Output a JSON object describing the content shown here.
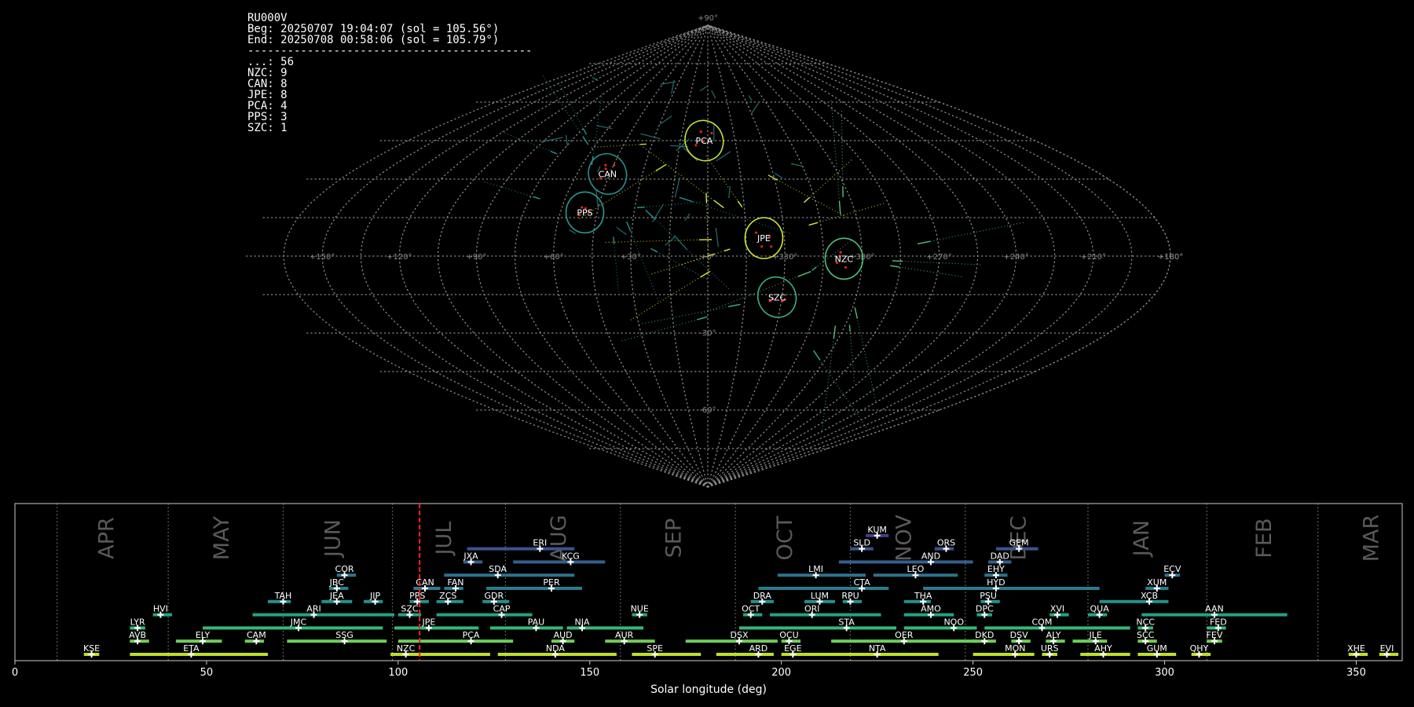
{
  "header": {
    "station": "RU000V",
    "begin": "Beg: 20250707 19:04:07 (sol = 105.56°)",
    "end": "End: 20250708 00:58:06 (sol = 105.79°)",
    "separator": "-------------------------------------------",
    "counts": [
      {
        "code": "...",
        "count": 56
      },
      {
        "code": "NZC",
        "count": 9
      },
      {
        "code": "CAN",
        "count": 8
      },
      {
        "code": "JPE",
        "count": 8
      },
      {
        "code": "PCA",
        "count": 4
      },
      {
        "code": "PPS",
        "count": 3
      },
      {
        "code": "SZC",
        "count": 1
      }
    ]
  },
  "chart_data": [
    {
      "type": "scatter",
      "projection": "sinusoidal",
      "ra_ticks": [
        "+180°",
        "+150°",
        "+120°",
        "+90°",
        "+60°",
        "+30°",
        "+0°",
        "+330°",
        "+300°",
        "+270°",
        "+240°",
        "+210°",
        "+180°"
      ],
      "dec_ticks": [
        "+90°",
        "-30°",
        "-60°",
        "-90°"
      ],
      "showers": [
        {
          "code": "PCA",
          "ra": 2,
          "dec": 45,
          "color": "#c5e03c"
        },
        {
          "code": "CAN",
          "ra": 46,
          "dec": 32,
          "color": "#2a8c8c"
        },
        {
          "code": "PPS",
          "ra": 50,
          "dec": 17,
          "color": "#2a9a8f"
        },
        {
          "code": "JPE",
          "ra": 338,
          "dec": 7,
          "color": "#d6e834"
        },
        {
          "code": "NZC",
          "ra": 307,
          "dec": -1,
          "color": "#52c07a"
        },
        {
          "code": "SZC",
          "ra": 332,
          "dec": -16,
          "color": "#3bb08a"
        }
      ]
    },
    {
      "type": "timeline",
      "xlabel": "Solar longitude (deg)",
      "xlim": [
        0,
        362
      ],
      "x_ticks": [
        0,
        50,
        100,
        150,
        200,
        250,
        300,
        350
      ],
      "current_sol": 105.6,
      "months": [
        {
          "label": "APR",
          "sol": 24
        },
        {
          "label": "MAY",
          "sol": 54
        },
        {
          "label": "JUN",
          "sol": 83
        },
        {
          "label": "JUL",
          "sol": 112
        },
        {
          "label": "AUG",
          "sol": 142
        },
        {
          "label": "SEP",
          "sol": 172
        },
        {
          "label": "OCT",
          "sol": 201
        },
        {
          "label": "NOV",
          "sol": 232
        },
        {
          "label": "DEC",
          "sol": 262
        },
        {
          "label": "JAN",
          "sol": 294
        },
        {
          "label": "FEB",
          "sol": 326
        },
        {
          "label": "MAR",
          "sol": 354
        }
      ],
      "month_boundaries": [
        11,
        40,
        70,
        98.5,
        128,
        158,
        188,
        218,
        248,
        280,
        311,
        340
      ],
      "showers": [
        {
          "code": "KUM",
          "start": 222,
          "end": 228,
          "peak": 225,
          "row": 10,
          "color": "#433e85"
        },
        {
          "code": "ERI",
          "start": 118,
          "end": 146,
          "peak": 137,
          "row": 9,
          "color": "#3b528b"
        },
        {
          "code": "SLD",
          "start": 218,
          "end": 224,
          "peak": 221,
          "row": 9,
          "color": "#3b528b"
        },
        {
          "code": "ORS",
          "start": 240,
          "end": 245,
          "peak": 243,
          "row": 9,
          "color": "#3b528b"
        },
        {
          "code": "GEM",
          "start": 256,
          "end": 267,
          "peak": 262,
          "row": 9,
          "color": "#3b528b"
        },
        {
          "code": "JXA",
          "start": 117,
          "end": 122,
          "peak": 119,
          "row": 8,
          "color": "#355f8d"
        },
        {
          "code": "KCG",
          "start": 130,
          "end": 154,
          "peak": 145,
          "row": 8,
          "color": "#355f8d"
        },
        {
          "code": "AND",
          "start": 215,
          "end": 250,
          "peak": 239,
          "row": 8,
          "color": "#355f8d"
        },
        {
          "code": "DAD",
          "start": 254,
          "end": 260,
          "peak": 257,
          "row": 8,
          "color": "#355f8d"
        },
        {
          "code": "COR",
          "start": 84,
          "end": 89,
          "peak": 86,
          "row": 7,
          "color": "#2c728e"
        },
        {
          "code": "SDA",
          "start": 112,
          "end": 146,
          "peak": 126,
          "row": 7,
          "color": "#2c728e"
        },
        {
          "code": "LMI",
          "start": 199,
          "end": 222,
          "peak": 209,
          "row": 7,
          "color": "#2c728e"
        },
        {
          "code": "LEO",
          "start": 224,
          "end": 246,
          "peak": 235,
          "row": 7,
          "color": "#2c728e"
        },
        {
          "code": "EHY",
          "start": 253,
          "end": 259,
          "peak": 256,
          "row": 7,
          "color": "#2c728e"
        },
        {
          "code": "ECV",
          "start": 300,
          "end": 304,
          "peak": 302,
          "row": 7,
          "color": "#2c728e"
        },
        {
          "code": "JBC",
          "start": 82,
          "end": 87,
          "peak": 84,
          "row": 6,
          "color": "#287d8e"
        },
        {
          "code": "CAN",
          "start": 104,
          "end": 111,
          "peak": 107,
          "row": 6,
          "color": "#287d8e"
        },
        {
          "code": "FAN",
          "start": 112,
          "end": 117,
          "peak": 115,
          "row": 6,
          "color": "#287d8e"
        },
        {
          "code": "PER",
          "start": 123,
          "end": 148,
          "peak": 140,
          "row": 6,
          "color": "#287d8e"
        },
        {
          "code": "CTA",
          "start": 194,
          "end": 228,
          "peak": 221,
          "row": 6,
          "color": "#287d8e"
        },
        {
          "code": "HYD",
          "start": 237,
          "end": 283,
          "peak": 256,
          "row": 6,
          "color": "#287d8e"
        },
        {
          "code": "XUM",
          "start": 295,
          "end": 301,
          "peak": 298,
          "row": 6,
          "color": "#287d8e"
        },
        {
          "code": "TAH",
          "start": 66,
          "end": 72,
          "peak": 70,
          "row": 5,
          "color": "#21918c"
        },
        {
          "code": "JEA",
          "start": 80,
          "end": 88,
          "peak": 84,
          "row": 5,
          "color": "#21918c"
        },
        {
          "code": "JIP",
          "start": 91,
          "end": 96,
          "peak": 94,
          "row": 5,
          "color": "#21918c"
        },
        {
          "code": "PPS",
          "start": 103,
          "end": 108,
          "peak": 105,
          "row": 5,
          "color": "#21918c"
        },
        {
          "code": "ZCS",
          "start": 110,
          "end": 117,
          "peak": 113,
          "row": 5,
          "color": "#21918c"
        },
        {
          "code": "GDR",
          "start": 122,
          "end": 129,
          "peak": 125,
          "row": 5,
          "color": "#21918c"
        },
        {
          "code": "DRA",
          "start": 192,
          "end": 198,
          "peak": 195,
          "row": 5,
          "color": "#21918c"
        },
        {
          "code": "LUM",
          "start": 206,
          "end": 214,
          "peak": 210,
          "row": 5,
          "color": "#21918c"
        },
        {
          "code": "RPU",
          "start": 216,
          "end": 221,
          "peak": 218,
          "row": 5,
          "color": "#21918c"
        },
        {
          "code": "THA",
          "start": 232,
          "end": 239,
          "peak": 237,
          "row": 5,
          "color": "#21918c"
        },
        {
          "code": "PSU",
          "start": 252,
          "end": 257,
          "peak": 254,
          "row": 5,
          "color": "#21918c"
        },
        {
          "code": "XCB",
          "start": 283,
          "end": 301,
          "peak": 296,
          "row": 5,
          "color": "#21918c"
        },
        {
          "code": "HVI",
          "start": 36,
          "end": 41,
          "peak": 38,
          "row": 4,
          "color": "#20a386"
        },
        {
          "code": "ARI",
          "start": 62,
          "end": 99,
          "peak": 78,
          "row": 4,
          "color": "#20a386"
        },
        {
          "code": "SZC",
          "start": 100,
          "end": 106,
          "peak": 103,
          "row": 4,
          "color": "#20a386"
        },
        {
          "code": "CAP",
          "start": 110,
          "end": 135,
          "peak": 127,
          "row": 4,
          "color": "#20a386"
        },
        {
          "code": "NUE",
          "start": 161,
          "end": 165,
          "peak": 163,
          "row": 4,
          "color": "#20a386"
        },
        {
          "code": "OCT",
          "start": 190,
          "end": 195,
          "peak": 192,
          "row": 4,
          "color": "#20a386"
        },
        {
          "code": "ORI",
          "start": 197,
          "end": 226,
          "peak": 208,
          "row": 4,
          "color": "#20a386"
        },
        {
          "code": "AMO",
          "start": 232,
          "end": 245,
          "peak": 239,
          "row": 4,
          "color": "#20a386"
        },
        {
          "code": "DPC",
          "start": 251,
          "end": 255,
          "peak": 253,
          "row": 4,
          "color": "#20a386"
        },
        {
          "code": "XVI",
          "start": 270,
          "end": 275,
          "peak": 272,
          "row": 4,
          "color": "#20a386"
        },
        {
          "code": "QUA",
          "start": 280,
          "end": 285,
          "peak": 283,
          "row": 4,
          "color": "#20a386"
        },
        {
          "code": "AAN",
          "start": 294,
          "end": 332,
          "peak": 313,
          "row": 4,
          "color": "#20a386"
        },
        {
          "code": "LYR",
          "start": 30,
          "end": 34,
          "peak": 32,
          "row": 3,
          "color": "#35b779"
        },
        {
          "code": "JMC",
          "start": 49,
          "end": 96,
          "peak": 74,
          "row": 3,
          "color": "#35b779"
        },
        {
          "code": "JPE",
          "start": 99,
          "end": 121,
          "peak": 108,
          "row": 3,
          "color": "#35b779"
        },
        {
          "code": "PAU",
          "start": 124,
          "end": 143,
          "peak": 136,
          "row": 3,
          "color": "#35b779"
        },
        {
          "code": "NIA",
          "start": 144,
          "end": 164,
          "peak": 148,
          "row": 3,
          "color": "#35b779"
        },
        {
          "code": "STA",
          "start": 189,
          "end": 230,
          "peak": 217,
          "row": 3,
          "color": "#35b779"
        },
        {
          "code": "NOO",
          "start": 232,
          "end": 251,
          "peak": 245,
          "row": 3,
          "color": "#35b779"
        },
        {
          "code": "COM",
          "start": 253,
          "end": 291,
          "peak": 268,
          "row": 3,
          "color": "#35b779"
        },
        {
          "code": "NCC",
          "start": 293,
          "end": 297,
          "peak": 295,
          "row": 3,
          "color": "#35b779"
        },
        {
          "code": "FED",
          "start": 311,
          "end": 316,
          "peak": 314,
          "row": 3,
          "color": "#35b779"
        },
        {
          "code": "AVB",
          "start": 30,
          "end": 35,
          "peak": 32,
          "row": 2,
          "color": "#6ece58"
        },
        {
          "code": "ELY",
          "start": 42,
          "end": 54,
          "peak": 49,
          "row": 2,
          "color": "#6ece58"
        },
        {
          "code": "CAM",
          "start": 60,
          "end": 65,
          "peak": 63,
          "row": 2,
          "color": "#6ece58"
        },
        {
          "code": "SSG",
          "start": 71,
          "end": 97,
          "peak": 86,
          "row": 2,
          "color": "#6ece58"
        },
        {
          "code": "PCA",
          "start": 100,
          "end": 130,
          "peak": 119,
          "row": 2,
          "color": "#6ece58"
        },
        {
          "code": "AUD",
          "start": 140,
          "end": 146,
          "peak": 143,
          "row": 2,
          "color": "#6ece58"
        },
        {
          "code": "AUR",
          "start": 154,
          "end": 167,
          "peak": 159,
          "row": 2,
          "color": "#6ece58"
        },
        {
          "code": "DSX",
          "start": 175,
          "end": 199,
          "peak": 189,
          "row": 2,
          "color": "#6ece58"
        },
        {
          "code": "OCU",
          "start": 200,
          "end": 205,
          "peak": 202,
          "row": 2,
          "color": "#6ece58"
        },
        {
          "code": "OER",
          "start": 213,
          "end": 251,
          "peak": 232,
          "row": 2,
          "color": "#6ece58"
        },
        {
          "code": "DKD",
          "start": 250,
          "end": 256,
          "peak": 253,
          "row": 2,
          "color": "#6ece58"
        },
        {
          "code": "DSV",
          "start": 260,
          "end": 265,
          "peak": 262,
          "row": 2,
          "color": "#6ece58"
        },
        {
          "code": "ALY",
          "start": 269,
          "end": 274,
          "peak": 271,
          "row": 2,
          "color": "#6ece58"
        },
        {
          "code": "JLE",
          "start": 276,
          "end": 285,
          "peak": 282,
          "row": 2,
          "color": "#6ece58"
        },
        {
          "code": "SCC",
          "start": 293,
          "end": 298,
          "peak": 295,
          "row": 2,
          "color": "#6ece58"
        },
        {
          "code": "FEV",
          "start": 311,
          "end": 315,
          "peak": 313,
          "row": 2,
          "color": "#6ece58"
        },
        {
          "code": "KSE",
          "start": 18,
          "end": 22,
          "peak": 20,
          "row": 1,
          "color": "#bddf26"
        },
        {
          "code": "ETA",
          "start": 30,
          "end": 66,
          "peak": 46,
          "row": 1,
          "color": "#bddf26"
        },
        {
          "code": "NZC",
          "start": 98,
          "end": 124,
          "peak": 102,
          "row": 1,
          "color": "#bddf26"
        },
        {
          "code": "NDA",
          "start": 126,
          "end": 157,
          "peak": 141,
          "row": 1,
          "color": "#bddf26"
        },
        {
          "code": "SPE",
          "start": 161,
          "end": 179,
          "peak": 167,
          "row": 1,
          "color": "#bddf26"
        },
        {
          "code": "ARD",
          "start": 183,
          "end": 198,
          "peak": 194,
          "row": 1,
          "color": "#bddf26"
        },
        {
          "code": "EGE",
          "start": 200,
          "end": 206,
          "peak": 203,
          "row": 1,
          "color": "#bddf26"
        },
        {
          "code": "NTA",
          "start": 206,
          "end": 241,
          "peak": 225,
          "row": 1,
          "color": "#bddf26"
        },
        {
          "code": "MON",
          "start": 250,
          "end": 266,
          "peak": 261,
          "row": 1,
          "color": "#bddf26"
        },
        {
          "code": "URS",
          "start": 268,
          "end": 272,
          "peak": 270,
          "row": 1,
          "color": "#bddf26"
        },
        {
          "code": "AHY",
          "start": 278,
          "end": 291,
          "peak": 284,
          "row": 1,
          "color": "#bddf26"
        },
        {
          "code": "GUM",
          "start": 293,
          "end": 303,
          "peak": 298,
          "row": 1,
          "color": "#bddf26"
        },
        {
          "code": "QHY",
          "start": 307,
          "end": 312,
          "peak": 309,
          "row": 1,
          "color": "#bddf26"
        },
        {
          "code": "XHE",
          "start": 348,
          "end": 353,
          "peak": 350,
          "row": 1,
          "color": "#bddf26"
        },
        {
          "code": "EVI",
          "start": 356,
          "end": 361,
          "peak": 358,
          "row": 1,
          "color": "#bddf26"
        }
      ]
    }
  ]
}
